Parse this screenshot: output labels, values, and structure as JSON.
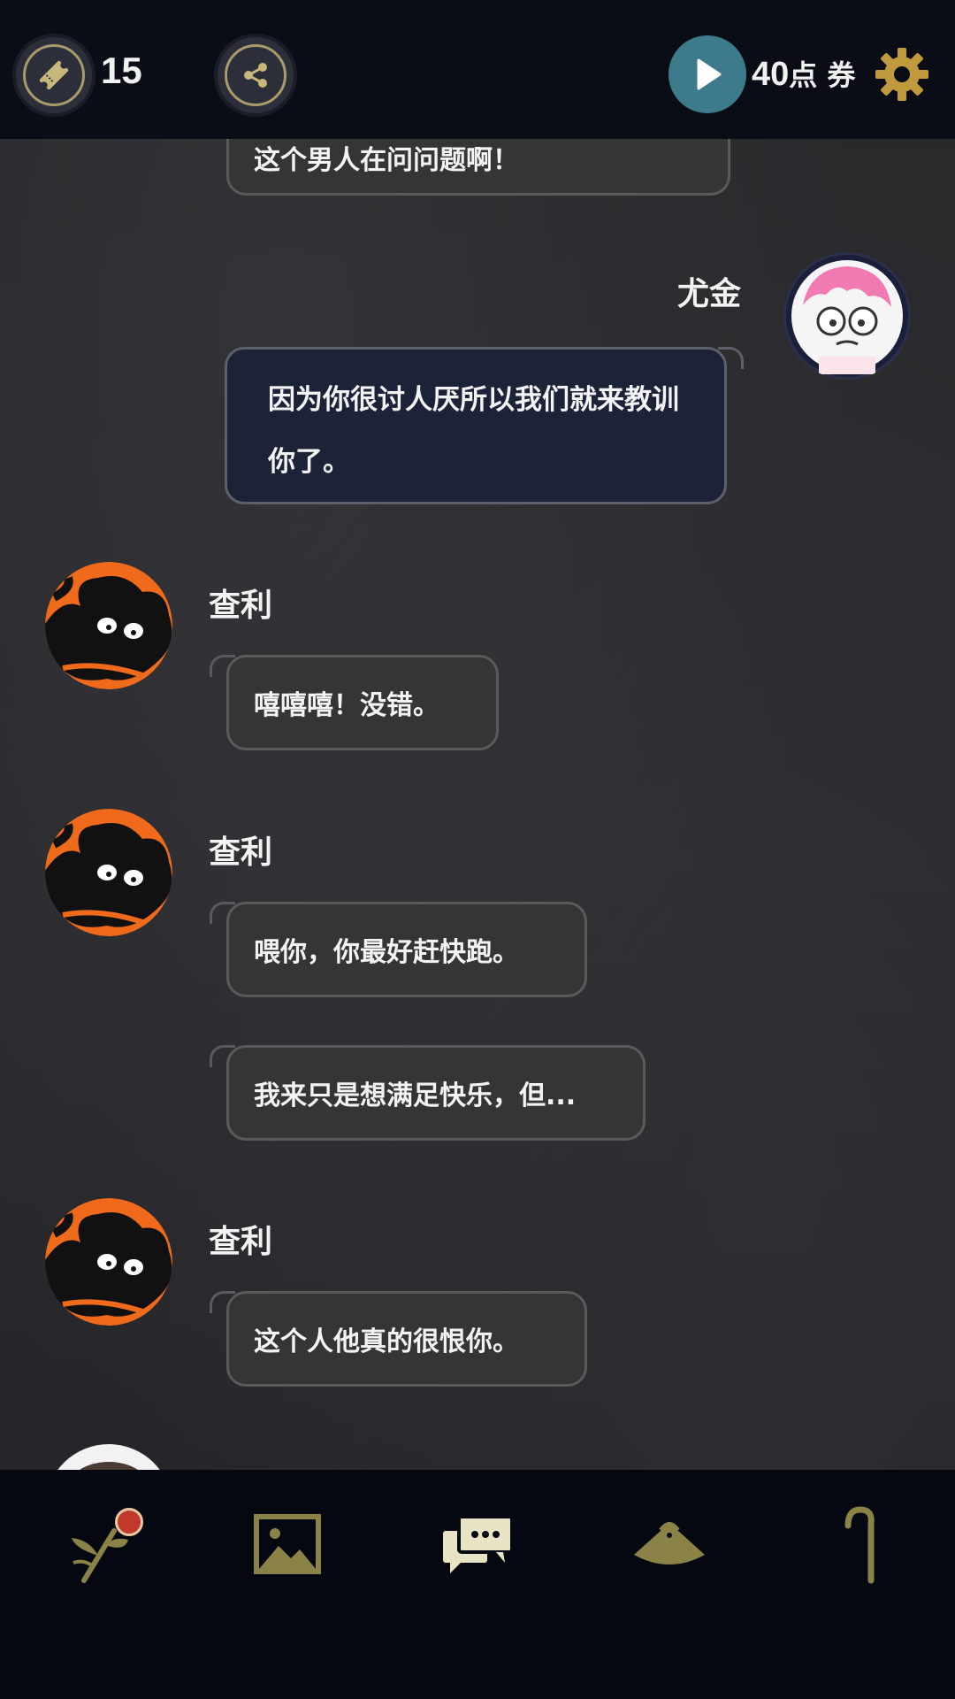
{
  "header": {
    "ticket_count": "15",
    "points_value": "40",
    "points_unit": "点 券",
    "icons": {
      "ticket": "ticket-icon",
      "share": "share-icon",
      "play": "play-icon",
      "settings": "gear-icon"
    }
  },
  "chat": {
    "messages": [
      {
        "text": "这个男人在问问题啊！"
      },
      {
        "speaker": "尤金",
        "text": "因为你很讨人厌所以我们就来教训你了。"
      },
      {
        "speaker": "查利",
        "text": "嘻嘻嘻！没错。"
      },
      {
        "speaker": "查利",
        "text": "喂你，你最好赶快跑。"
      },
      {
        "text": "我来只是想满足快乐，但..."
      },
      {
        "speaker": "查利",
        "text": "这个人他真的很恨你。"
      }
    ]
  },
  "nav": {
    "items": [
      {
        "icon": "flower-branch-icon"
      },
      {
        "icon": "gallery-image-icon"
      },
      {
        "icon": "chat-bubbles-icon"
      },
      {
        "icon": "straw-hat-icon"
      },
      {
        "icon": "cane-icon"
      }
    ]
  },
  "colors": {
    "topbar": "#0a0d16",
    "bubble_other": "#353535",
    "bubble_me": "#1c2238",
    "gold": "#a89a6a",
    "play": "#3d7a8c",
    "avatar_orange": "#f06a1c"
  }
}
